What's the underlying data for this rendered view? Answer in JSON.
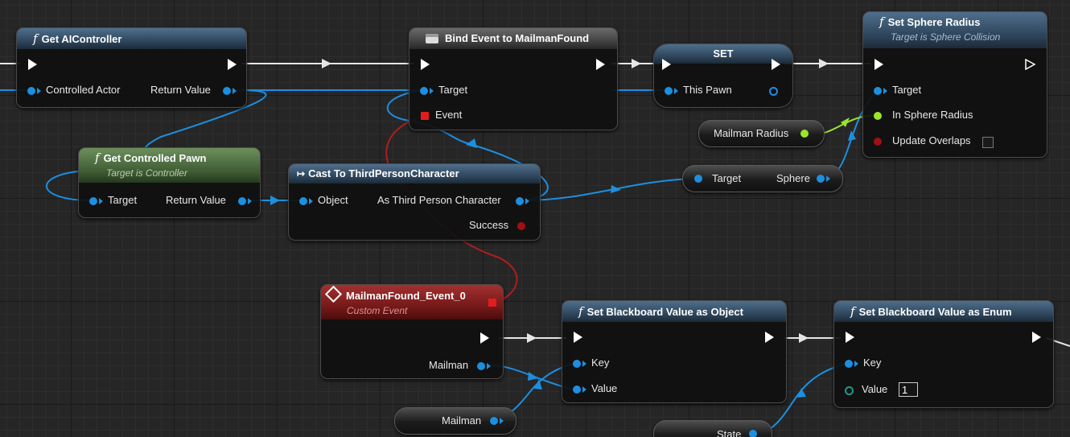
{
  "nodes": {
    "get_ai_controller": {
      "title": "Get AIController",
      "in_pin": "Controlled Actor",
      "out_pin": "Return Value"
    },
    "bind_event": {
      "title": "Bind Event to MailmanFound",
      "target": "Target",
      "event": "Event"
    },
    "set_pawn": {
      "title": "SET",
      "pin": "This Pawn"
    },
    "set_sphere_radius": {
      "title": "Set Sphere Radius",
      "subtitle": "Target is Sphere Collision",
      "target": "Target",
      "radius": "In Sphere Radius",
      "overlaps": "Update Overlaps"
    },
    "mailman_radius": {
      "label": "Mailman Radius"
    },
    "get_controlled_pawn": {
      "title": "Get Controlled Pawn",
      "subtitle": "Target is Controller",
      "target": "Target",
      "out_pin": "Return Value"
    },
    "cast_node": {
      "title": "Cast To ThirdPersonCharacter",
      "object": "Object",
      "as_pin": "As Third Person Character",
      "success": "Success"
    },
    "sphere_getter": {
      "target": "Target",
      "out_pin": "Sphere"
    },
    "custom_event": {
      "title": "MailmanFound_Event_0",
      "subtitle": "Custom Event",
      "out_pin": "Mailman"
    },
    "set_bb_object": {
      "title": "Set Blackboard Value as Object",
      "key": "Key",
      "value": "Value"
    },
    "set_bb_enum": {
      "title": "Set Blackboard Value as Enum",
      "key": "Key",
      "value": "Value",
      "value_default": "1"
    },
    "mailman_var": {
      "label": "Mailman"
    },
    "state_var": {
      "label": "State"
    }
  },
  "icons": {
    "function": "f",
    "cast": "↦"
  },
  "colors": {
    "exec": "#ffffff",
    "object_pin": "#1c8fe0",
    "float_pin": "#9be52b",
    "delegate_pin": "#e21d1d",
    "bool_pin": "#a01010",
    "byte_pin": "#1e9b8a"
  }
}
